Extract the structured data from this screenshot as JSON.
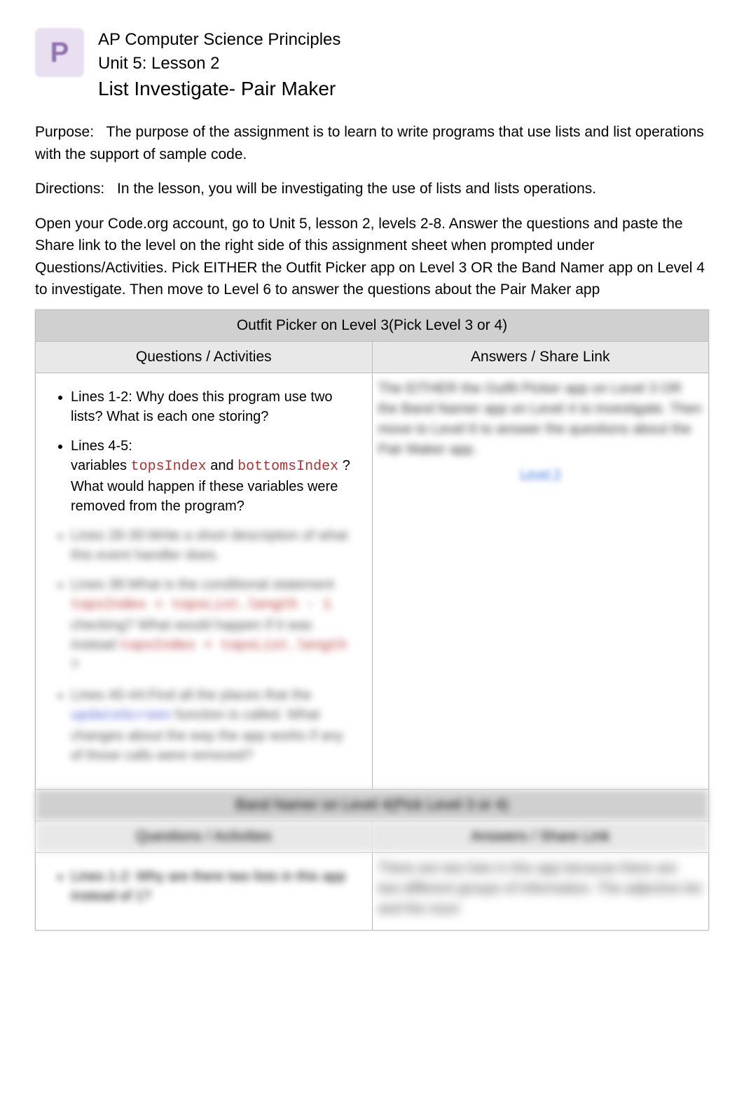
{
  "header": {
    "logo_glyph": "P",
    "course": "AP Computer Science Principles",
    "unit": "Unit 5: Lesson 2",
    "title": "List Investigate- Pair Maker"
  },
  "purpose": {
    "label": "Purpose:",
    "text": "The purpose of the assignment is to learn to write programs that use lists and list operations with the support of sample code."
  },
  "directions": {
    "label": "Directions:",
    "text": "In the lesson, you will be investigating the use of lists and lists operations."
  },
  "instructions": {
    "p1a": "Open your Code.org account, go to Unit 5, lesson 2, levels 2-8. Answer the questions and paste the Share link to the level on the right side of this assignment sheet when prompted under Questions/Activities. Pick ",
    "p1b": "EITHER the Outfit Picker app on ",
    "p1c": "Level 3 OR ",
    "p1d": "the Band Namer app on Level 4 ",
    "p1e": "to investigate. Then move to ",
    "p1f": "Level 6 ",
    "p1g": "to answer the questions about the Pair Maker app"
  },
  "table": {
    "section1_title": "Outfit Picker on Level 3(Pick Level 3 or 4)",
    "col_q": "Questions / Activities",
    "col_a": "Answers / Share Link",
    "q1": {
      "li1_a": "Lines 1-2: ",
      "li1_b": "Why does this program use two lists? What is each one storing?",
      "li2_a": "Lines 4-5:",
      "li2_b": "variables ",
      "li2_var1": "topsIndex",
      "li2_c": " and ",
      "li2_var2": "bottomsIndex",
      "li2_d": " ? What would happen if these variables were removed from the program?",
      "li3": "Lines 28-30:Write a short description of what this event handler does.",
      "li4_a": "Lines 38:What is the conditional statement ",
      "li4_code1": "topsIndex < topsList.length - 1",
      "li4_b": " checking? What would happen if it was instead ",
      "li4_code2": "topsIndex < topsList.length",
      "li4_c": "?",
      "li5_a": "Lines 40-44:Find all the places that the ",
      "li5_code": "updateScreen",
      "li5_b": " function is called. What changes about the way the app works if any of those calls were removed?"
    },
    "a1": {
      "blur_text": "The EITHER the Outfit Picker app on Level 3 OR the Band Namer app on Level 4 to investigate. Then move to Level 6 to answer the questions about the Pair Maker app.",
      "link": "Level 3"
    },
    "section2_title": "Band Namer on Level 4(Pick Level 3 or 4)",
    "col2_q": "Questions / Activities",
    "col2_a": "Answers / Share Link",
    "q2": {
      "li1": "Lines 1-2: Why are there two lists in this app instead of 1?"
    },
    "a2": {
      "blur_text": "There are two lists in this app because there are two different groups of information. The adjective list and the noun"
    }
  }
}
